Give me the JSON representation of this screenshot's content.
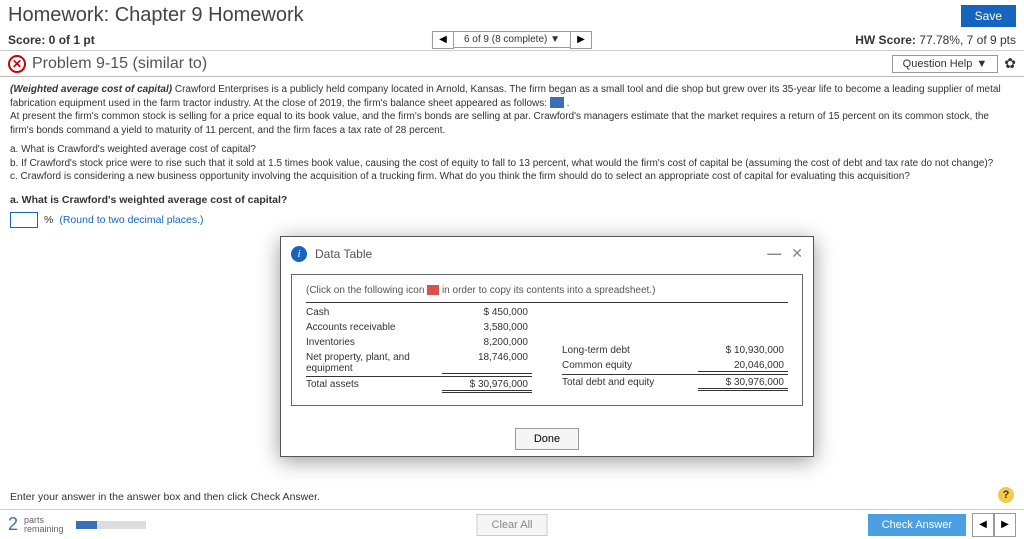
{
  "header": {
    "title": "Homework: Chapter 9 Homework",
    "save": "Save"
  },
  "row2": {
    "score": "Score: 0 of 1 pt",
    "pager": "6 of 9 (8 complete)",
    "hwscore_label": "HW Score:",
    "hwscore_val": "77.78%, 7 of 9 pts"
  },
  "row3": {
    "problem": "Problem 9-15 (similar to)",
    "qhelp": "Question Help"
  },
  "para": {
    "p1a": "(Weighted average cost of capital)",
    "p1b": " Crawford Enterprises is a publicly held company located in Arnold, Kansas. The firm began as a small tool and die shop but grew over its 35-year life to become a leading supplier of metal fabrication equipment used in the farm tractor industry. At the close of 2019, the firm's balance sheet appeared as follows: ",
    "p2": "At present the firm's common stock is selling for a price equal to its book value, and the firm's bonds are selling at par. Crawford's managers estimate that the market requires a return of 15 percent on its common stock, the firm's bonds command a yield to maturity of 11 percent, and the firm faces a tax rate of 28 percent.",
    "qa": "a. What is Crawford's weighted average cost of capital?",
    "qb": "b. If Crawford's stock price were to rise such that it sold at 1.5 times book value, causing the cost of equity to fall to 13 percent, what would the firm's cost of capital be (assuming the cost of debt and tax rate do not change)?",
    "qc": "c. Crawford is considering a new business opportunity involving the acquisition of a trucking firm. What do you think the firm should do to select an appropriate cost of capital for evaluating this acquisition?"
  },
  "answer": {
    "prompt": "a. What is Crawford's weighted average cost of capital?",
    "unit": "%",
    "round": "(Round to two decimal places.)"
  },
  "modal": {
    "title": "Data Table",
    "click_a": "(Click on the following icon ",
    "click_b": " in order to copy its contents into a spreadsheet.)",
    "left": [
      {
        "label": "Cash",
        "value": "450,000",
        "prefix": "$"
      },
      {
        "label": "Accounts receivable",
        "value": "3,580,000"
      },
      {
        "label": "Inventories",
        "value": "8,200,000"
      },
      {
        "label": "Net property, plant, and equipment",
        "value": "18,746,000",
        "underline": true
      },
      {
        "label": "Total assets",
        "value": "30,976,000",
        "prefix": "$",
        "total": true
      }
    ],
    "right": [
      {
        "label": "Long-term debt",
        "value": "10,930,000",
        "prefix": "$"
      },
      {
        "label": "Common equity",
        "value": "20,046,000",
        "underline": true
      },
      {
        "label": "Total debt and equity",
        "value": "30,976,000",
        "prefix": "$",
        "total": true
      }
    ],
    "done": "Done"
  },
  "chart_data": {
    "type": "table",
    "title": "Balance Sheet (close of 2019)",
    "assets": {
      "Cash": 450000,
      "Accounts receivable": 3580000,
      "Inventories": 8200000,
      "Net property, plant, and equipment": 18746000,
      "Total assets": 30976000
    },
    "liab_equity": {
      "Long-term debt": 10930000,
      "Common equity": 20046000,
      "Total debt and equity": 30976000
    }
  },
  "footer": {
    "note": "Enter your answer in the answer box and then click Check Answer.",
    "parts_num": "2",
    "parts_txt1": "parts",
    "parts_txt2": "remaining",
    "clear": "Clear All",
    "check": "Check Answer"
  }
}
